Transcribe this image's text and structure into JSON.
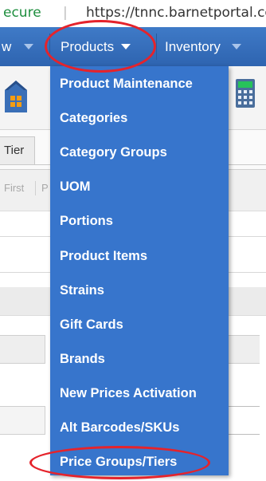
{
  "address_bar": {
    "security_label": "ecure",
    "separator": "|",
    "url": "https://tnnc.barnetportal.com"
  },
  "nav": {
    "items": [
      {
        "label": "w"
      },
      {
        "label": "Products"
      },
      {
        "label": "Inventory"
      }
    ]
  },
  "toolbar": {
    "icons": [
      "house-icon",
      "calculator-icon"
    ]
  },
  "tabs": {
    "tier_label": "Tier"
  },
  "pager": {
    "first_label": "First",
    "prev_label": "P"
  },
  "products_menu": {
    "items": [
      {
        "label": "Product Maintenance"
      },
      {
        "label": "Categories"
      },
      {
        "label": "Category Groups"
      },
      {
        "label": "UOM"
      },
      {
        "label": "Portions"
      },
      {
        "label": "Product Items"
      },
      {
        "label": "Strains"
      },
      {
        "label": "Gift Cards"
      },
      {
        "label": "Brands"
      },
      {
        "label": "New Prices Activation"
      },
      {
        "label": "Alt Barcodes/SKUs"
      },
      {
        "label": "Price Groups/Tiers"
      }
    ]
  },
  "colors": {
    "nav_bar": "#3a72c0",
    "menu_background": "#3775cc",
    "annotation": "#e5232b",
    "secure_green": "#1e8e3e"
  }
}
